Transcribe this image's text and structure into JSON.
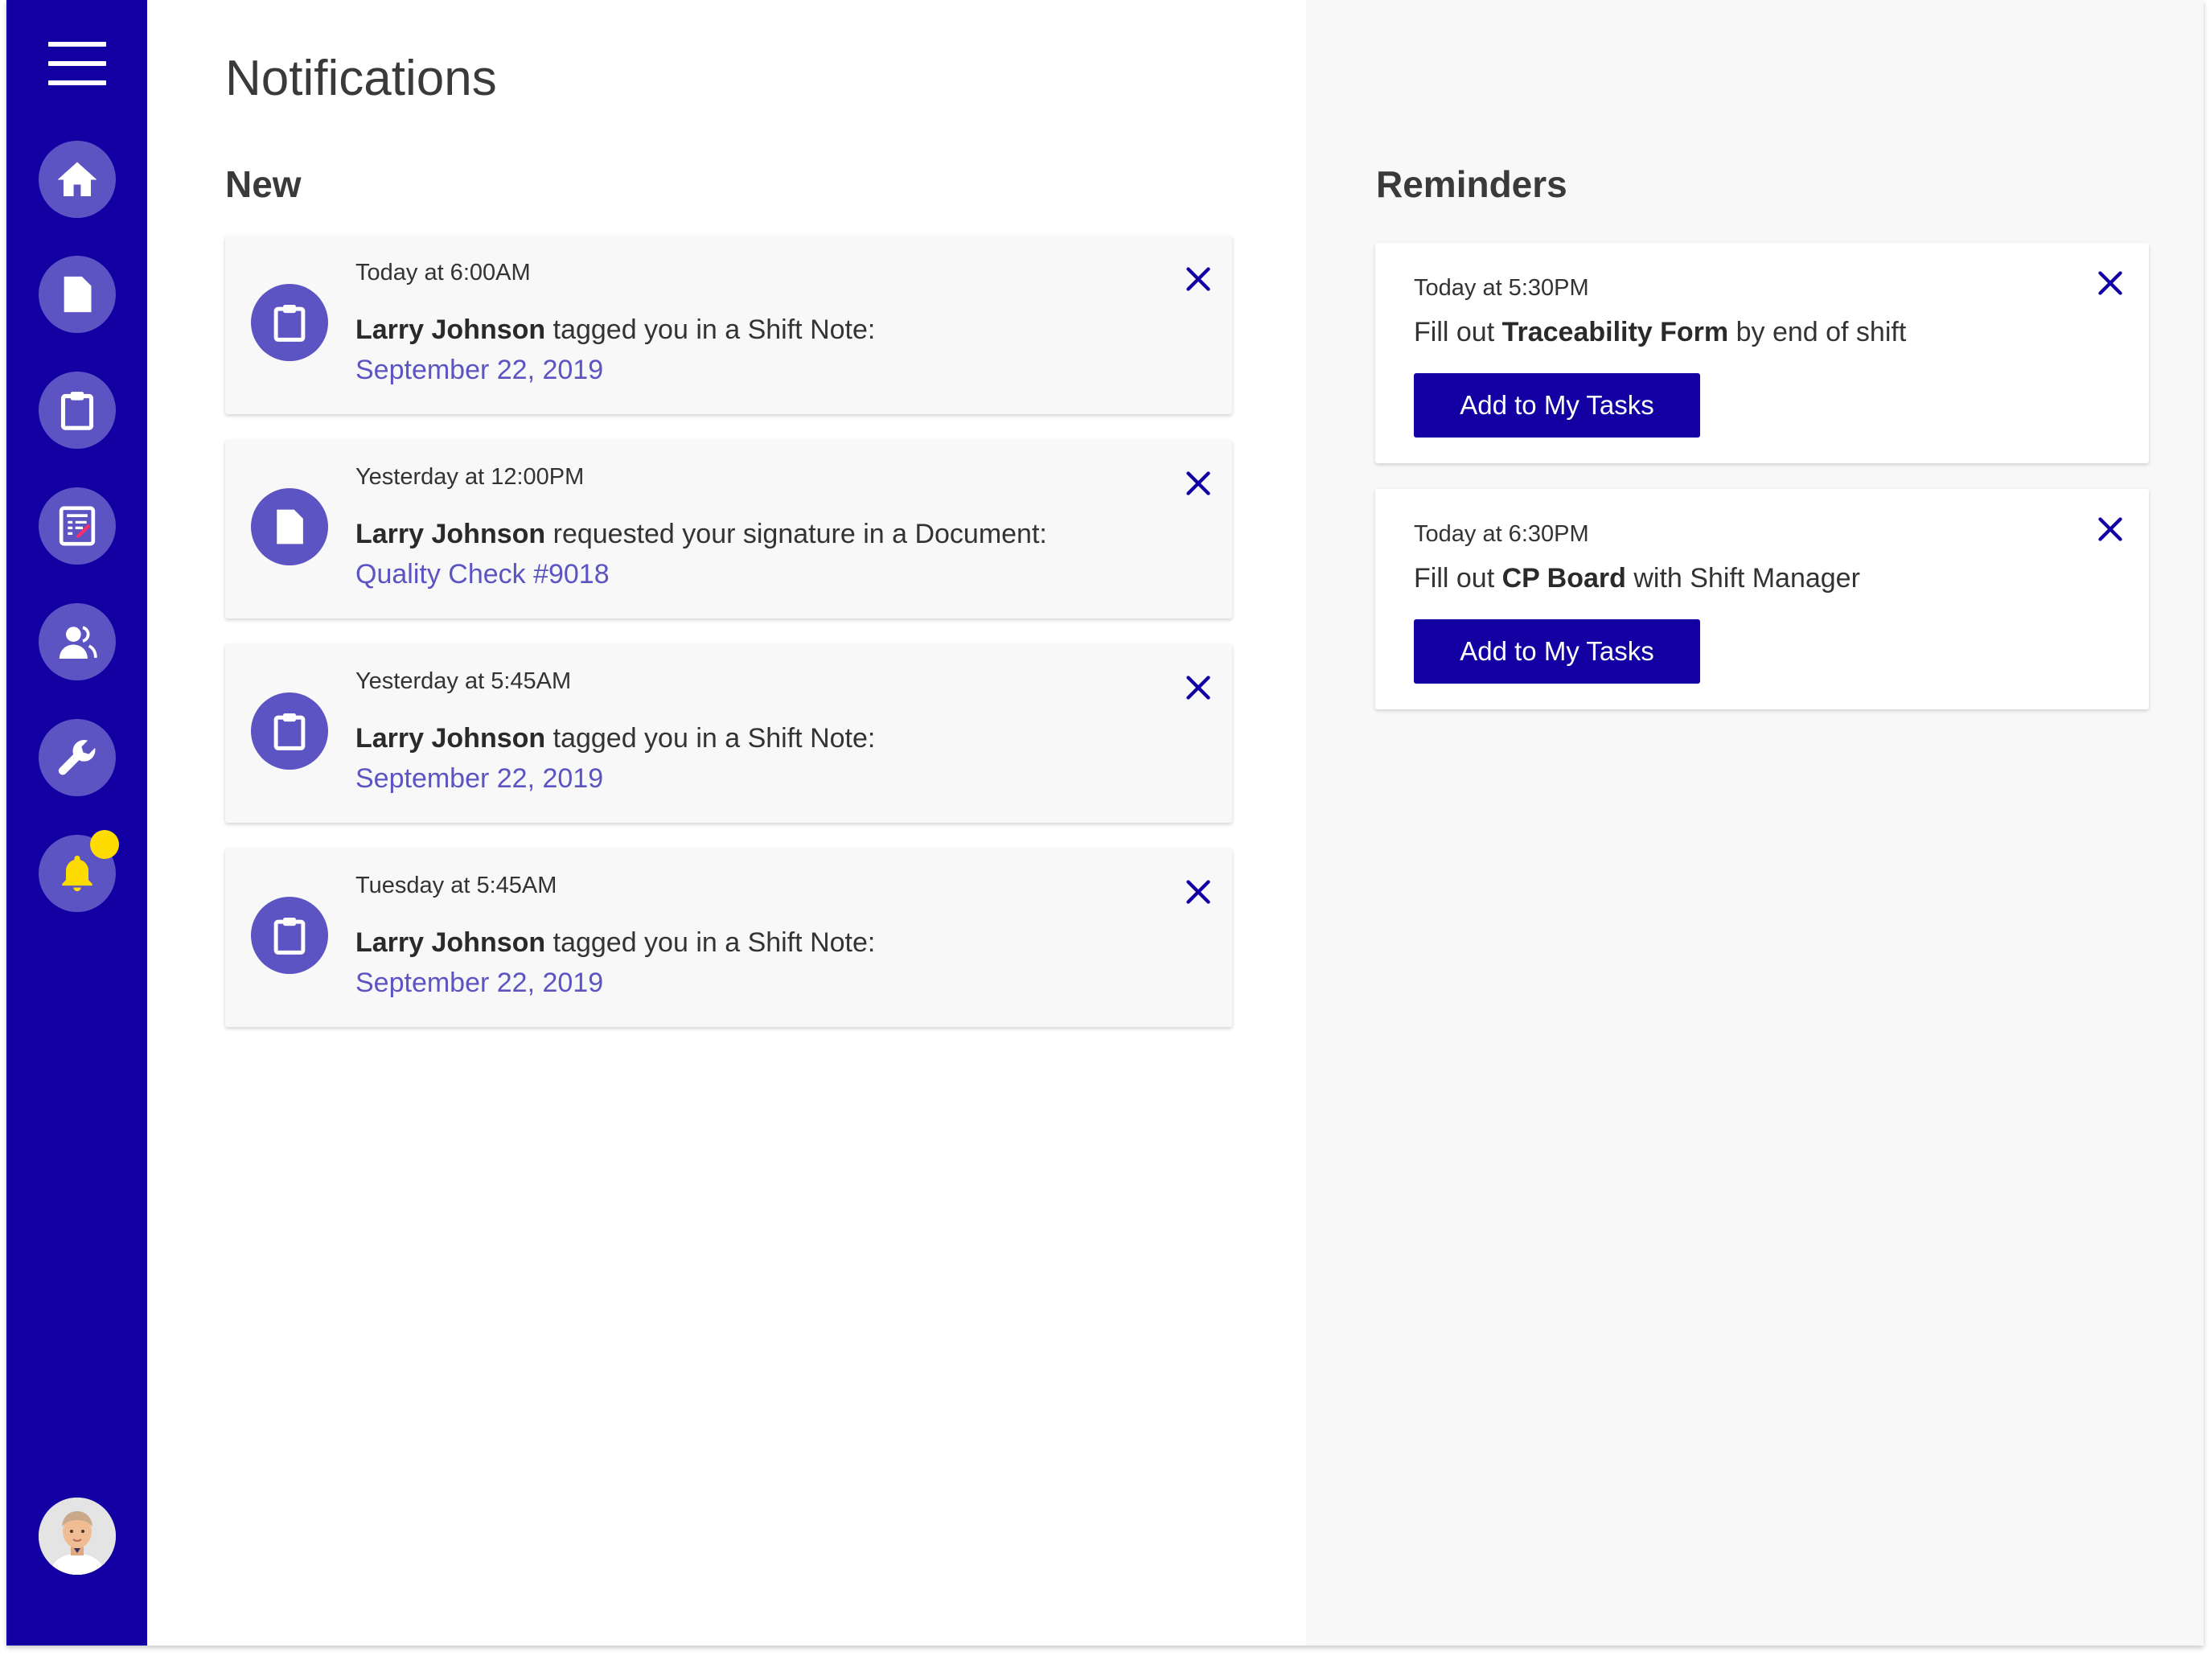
{
  "colors": {
    "sidebar": "#1300a3",
    "accent": "#5c54c3",
    "primary_button": "#1300a3",
    "close_icon": "#1300a3",
    "badge": "#ffdc00",
    "bell": "#ffdc00"
  },
  "sidebar": {
    "items": [
      {
        "name": "home",
        "icon": "home-icon"
      },
      {
        "name": "documents",
        "icon": "document-icon"
      },
      {
        "name": "shift-notes",
        "icon": "clipboard-icon"
      },
      {
        "name": "forms",
        "icon": "checklist-form-icon"
      },
      {
        "name": "team",
        "icon": "users-icon"
      },
      {
        "name": "maintenance",
        "icon": "wrench-icon"
      },
      {
        "name": "notifications",
        "icon": "bell-icon",
        "has_badge": true
      }
    ]
  },
  "page": {
    "title": "Notifications"
  },
  "new_section": {
    "title": "New",
    "notifications": [
      {
        "time": "Today at 6:00AM",
        "actor": "Larry Johnson",
        "action": " tagged you in a Shift Note:",
        "link": "September 22, 2019",
        "icon": "clipboard-icon"
      },
      {
        "time": "Yesterday at 12:00PM",
        "actor": "Larry Johnson",
        "action": " requested your signature in a Document:",
        "link": "Quality Check #9018",
        "icon": "document-icon"
      },
      {
        "time": "Yesterday at 5:45AM",
        "actor": "Larry Johnson",
        "action": " tagged you in a Shift Note:",
        "link": "September 22, 2019",
        "icon": "clipboard-icon"
      },
      {
        "time": "Tuesday at 5:45AM",
        "actor": "Larry Johnson",
        "action": " tagged you in a Shift Note:",
        "link": "September 22, 2019",
        "icon": "clipboard-icon"
      }
    ]
  },
  "reminders": {
    "title": "Reminders",
    "items": [
      {
        "time": "Today at 5:30PM",
        "prefix": "Fill out ",
        "bold": "Traceability Form",
        "suffix": " by end of shift",
        "button": "Add to My Tasks"
      },
      {
        "time": "Today at 6:30PM",
        "prefix": "Fill out ",
        "bold": "CP Board",
        "suffix": " with Shift Manager",
        "button": "Add to My Tasks"
      }
    ]
  }
}
